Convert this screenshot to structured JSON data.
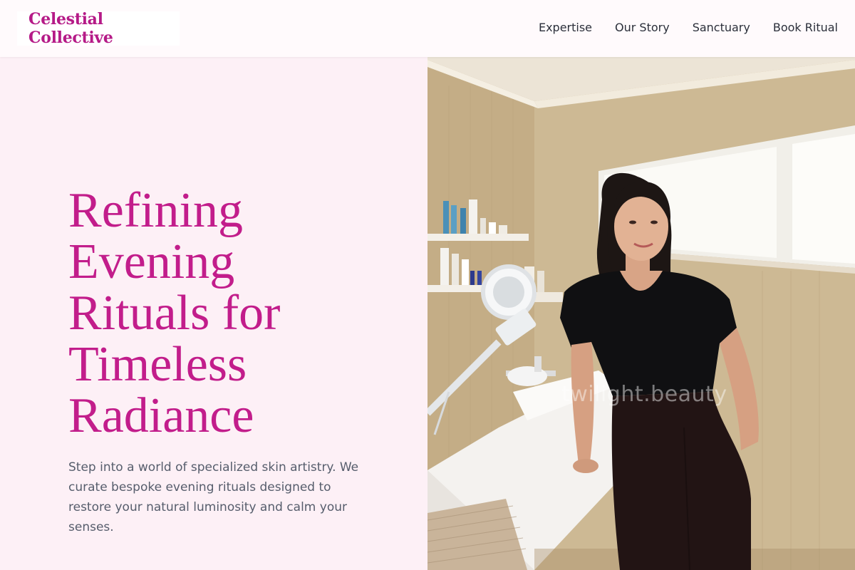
{
  "header": {
    "brand": "Celestial Collective",
    "nav": [
      "Expertise",
      "Our Story",
      "Sanctuary",
      "Book Ritual"
    ]
  },
  "hero": {
    "title_lines": [
      "Refining",
      "Evening",
      "Rituals for",
      "Timeless",
      "Radiance"
    ],
    "description": "Step into a world of specialized skin artistry. We curate bespoke evening rituals designed to restore your natural luminosity and calm your senses.",
    "image_watermark": "twilight.beauty"
  },
  "colors": {
    "brand": "#b51a87",
    "title": "#c21d8b",
    "hero_bg": "#fdf0f6",
    "body_text": "#565d6c",
    "nav_text": "#2b2f3a"
  }
}
